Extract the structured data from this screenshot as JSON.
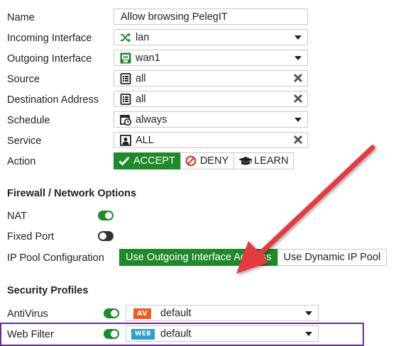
{
  "policy": {
    "name": {
      "label": "Name",
      "value": "Allow browsing PelegIT"
    },
    "incoming_interface": {
      "label": "Incoming Interface",
      "value": "lan",
      "icon": "shuffle-icon"
    },
    "outgoing_interface": {
      "label": "Outgoing Interface",
      "value": "wan1",
      "icon": "network-port-icon"
    },
    "source": {
      "label": "Source",
      "value": "all",
      "icon": "address-list-icon"
    },
    "destination": {
      "label": "Destination Address",
      "value": "all",
      "icon": "address-list-icon"
    },
    "schedule": {
      "label": "Schedule",
      "value": "always",
      "icon": "calendar-clock-icon"
    },
    "service": {
      "label": "Service",
      "value": "ALL",
      "icon": "service-icon"
    },
    "action": {
      "label": "Action",
      "options": [
        "ACCEPT",
        "DENY",
        "LEARN"
      ],
      "selected": "ACCEPT"
    }
  },
  "firewall_options": {
    "title": "Firewall / Network Options",
    "nat": {
      "label": "NAT",
      "enabled": true
    },
    "fixed_port": {
      "label": "Fixed Port",
      "enabled": false
    },
    "ip_pool": {
      "label": "IP Pool Configuration",
      "options": [
        "Use Outgoing Interface Address",
        "Use Dynamic IP Pool"
      ],
      "selected": "Use Outgoing Interface Address"
    }
  },
  "security_profiles": {
    "title": "Security Profiles",
    "antivirus": {
      "label": "AntiVirus",
      "enabled": true,
      "badge": "AV",
      "value": "default",
      "badge_color": "#f05a22"
    },
    "web_filter": {
      "label": "Web Filter",
      "enabled": true,
      "badge": "WEB",
      "value": "default",
      "badge_color": "#2a9fd0"
    }
  },
  "colors": {
    "accent": "#1e8a29",
    "highlight": "#6a2c91",
    "arrow": "#e8393f"
  }
}
